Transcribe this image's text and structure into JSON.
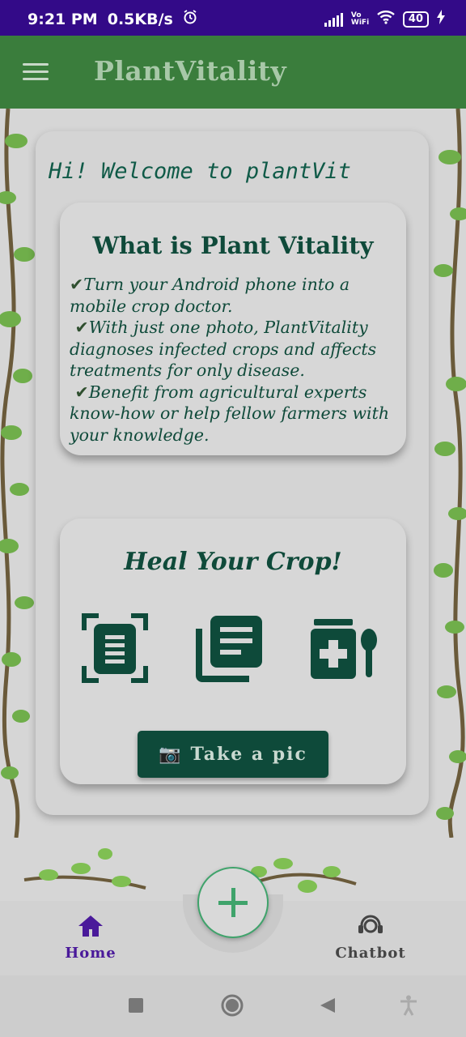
{
  "status_bar": {
    "time": "9:21 PM",
    "net_speed": "0.5KB/s",
    "wifi_label": "Vo\nWiFi",
    "battery": "40"
  },
  "app_bar": {
    "title": "PlantVitality",
    "menu_icon": "hamburger-menu-icon"
  },
  "main": {
    "welcome": "Hi! Welcome to plantVit",
    "info": {
      "title": "What is Plant Vitality",
      "points": [
        "Turn your Android phone into a mobile crop doctor.",
        "With just one photo, PlantVitality diagnoses infected crops and affects treatments for only disease.",
        "Benefit from agricultural experts know-how or help fellow farmers with your knowledge."
      ],
      "check_glyph": "✔"
    },
    "heal": {
      "title": "Heal Your Crop!",
      "icons": [
        "scan-document-icon",
        "library-books-icon",
        "medicine-icon"
      ],
      "button_label": "Take a pic",
      "button_emoji": "📷"
    }
  },
  "bottom_nav": {
    "home_label": "Home",
    "chatbot_label": "Chatbot",
    "fab_icon": "plus-icon"
  },
  "colors": {
    "status_bar": "#330a88",
    "app_bar": "#3a7d3c",
    "primary_dark_green": "#0e4a3a",
    "home_active": "#4a1a9a",
    "fab_border": "#3fa36b"
  }
}
